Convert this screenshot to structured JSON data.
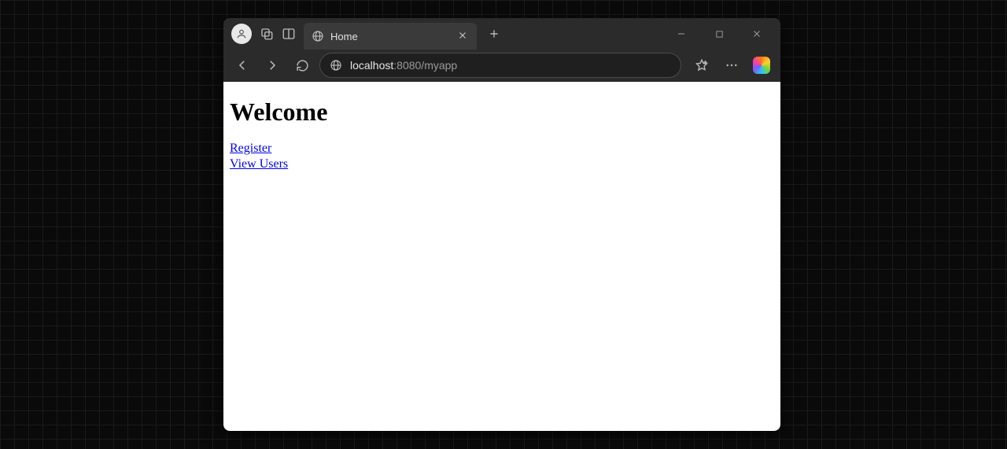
{
  "tab": {
    "title": "Home"
  },
  "address": {
    "host": "localhost",
    "port_path": ":8080/myapp"
  },
  "page": {
    "heading": "Welcome",
    "links": {
      "register": "Register",
      "view_users": "View Users"
    }
  },
  "icons": {
    "profile": "person-icon",
    "workspaces": "workspaces-icon",
    "split": "split-screen-icon",
    "globe": "globe-icon",
    "close": "close-icon",
    "plus": "plus-icon",
    "minimize": "minimize-icon",
    "maximize": "maximize-icon",
    "win_close": "window-close-icon",
    "back": "back-icon",
    "forward": "forward-icon",
    "refresh": "refresh-icon",
    "site_info": "site-info-icon",
    "favorite": "favorite-icon",
    "more": "more-icon",
    "copilot": "copilot-icon"
  }
}
